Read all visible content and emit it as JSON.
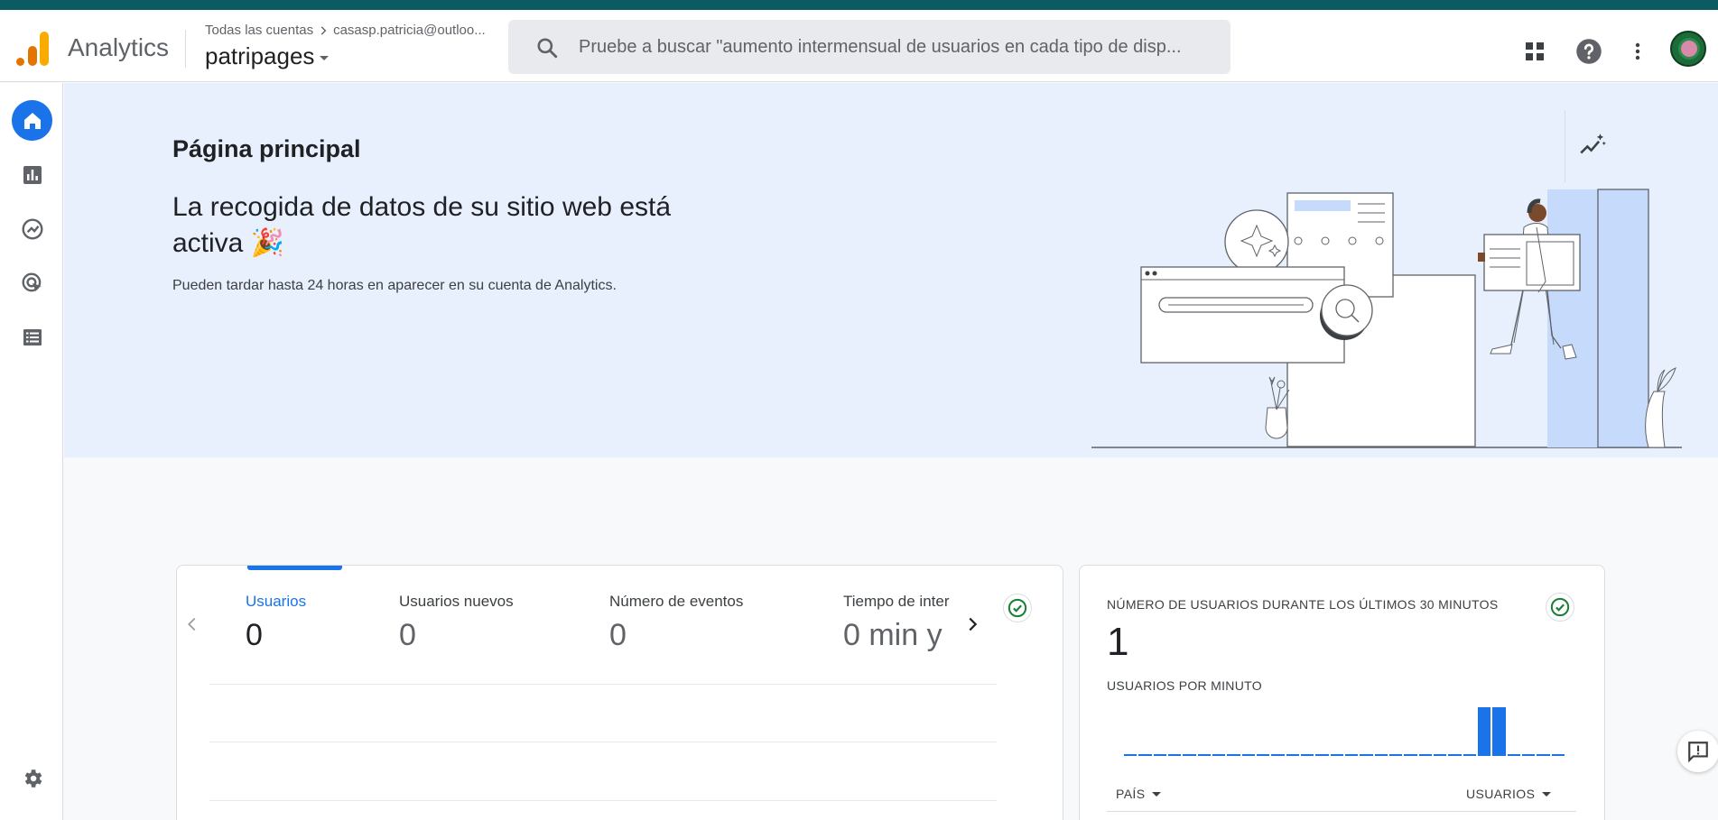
{
  "app": {
    "name": "Analytics",
    "breadcrumb_root": "Todas las cuentas",
    "breadcrumb_account": "casasp.patricia@outloo...",
    "property": "patripages"
  },
  "search": {
    "placeholder": "Pruebe a buscar \"aumento intermensual de usuarios en cada tipo de disp..."
  },
  "header_icons": [
    "apps-grid-icon",
    "help-icon",
    "more-vert-icon",
    "avatar"
  ],
  "sidebar": {
    "items": [
      {
        "name": "home-icon",
        "active": true
      },
      {
        "name": "reports-icon",
        "active": false
      },
      {
        "name": "explore-icon",
        "active": false
      },
      {
        "name": "advertising-icon",
        "active": false
      },
      {
        "name": "configure-icon",
        "active": false
      }
    ],
    "footer": "settings-icon"
  },
  "hero": {
    "page_title": "Página principal",
    "headline": "La recogida de datos de su sitio web está activa 🎉",
    "subtext": "Pueden tardar hasta 24 horas en aparecer en su cuenta de Analytics."
  },
  "metrics_card": {
    "metrics": [
      {
        "label": "Usuarios",
        "value": "0",
        "active": true
      },
      {
        "label": "Usuarios nuevos",
        "value": "0",
        "active": false
      },
      {
        "label": "Número de eventos",
        "value": "0",
        "active": false
      },
      {
        "label": "Tiempo de inter",
        "value": "0 min y",
        "active": false
      }
    ]
  },
  "realtime_card": {
    "title": "NÚMERO DE USUARIOS DURANTE LOS ÚLTIMOS 30 MINUTOS",
    "value": "1",
    "subtitle": "USUARIOS POR MINUTO",
    "per_minute": [
      0,
      0,
      0,
      0,
      0,
      0,
      0,
      0,
      0,
      0,
      0,
      0,
      0,
      0,
      0,
      0,
      0,
      0,
      0,
      0,
      0,
      0,
      0,
      0,
      1,
      1,
      0,
      0,
      0,
      0
    ],
    "col_country": "PAÍS",
    "col_users": "USUARIOS"
  },
  "colors": {
    "accent": "#1a73e8",
    "hero_bg": "#e8f0fe",
    "topstrip": "#0a5b62",
    "success": "#188038"
  }
}
